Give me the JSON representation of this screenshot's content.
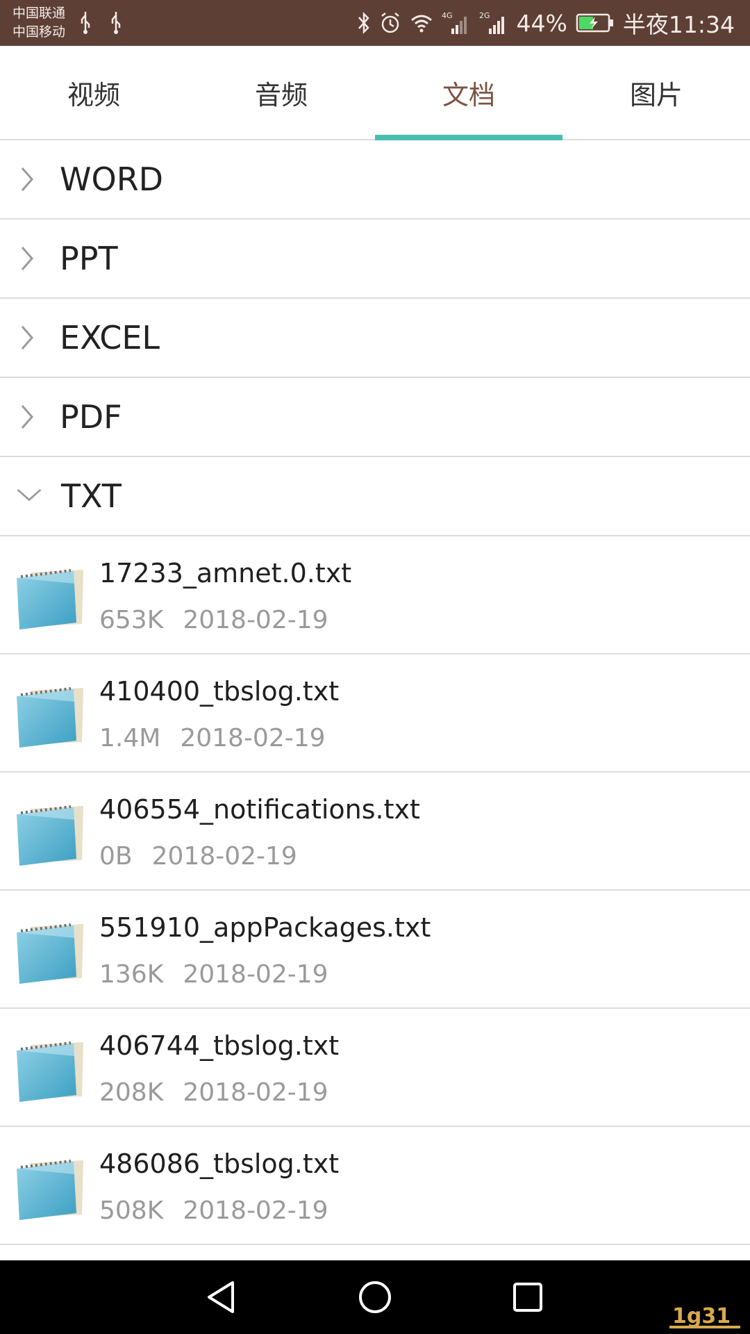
{
  "status_bar": {
    "carrier_1": "中国联通",
    "carrier_2": "中国移动",
    "network_1": "4G",
    "network_2": "2G",
    "battery": "44%",
    "time": "半夜11:34",
    "bg_color": "#5d3f36"
  },
  "tabs": [
    {
      "label": "视频",
      "active": false
    },
    {
      "label": "音频",
      "active": false
    },
    {
      "label": "文档",
      "active": true
    },
    {
      "label": "图片",
      "active": false
    }
  ],
  "accent_color": "#46bfb0",
  "categories": [
    {
      "label": "WORD",
      "expanded": false
    },
    {
      "label": "PPT",
      "expanded": false
    },
    {
      "label": "EXCEL",
      "expanded": false
    },
    {
      "label": "PDF",
      "expanded": false
    },
    {
      "label": "TXT",
      "expanded": true
    }
  ],
  "files": [
    {
      "name": "17233_amnet.0.txt",
      "size": "653K",
      "date": "2018-02-19",
      "icon": "notepad-icon"
    },
    {
      "name": "410400_tbslog.txt",
      "size": "1.4M",
      "date": "2018-02-19",
      "icon": "notepad-icon"
    },
    {
      "name": "406554_notifications.txt",
      "size": "0B",
      "date": "2018-02-19",
      "icon": "notepad-icon"
    },
    {
      "name": "551910_appPackages.txt",
      "size": "136K",
      "date": "2018-02-19",
      "icon": "notepad-icon"
    },
    {
      "name": "406744_tbslog.txt",
      "size": "208K",
      "date": "2018-02-19",
      "icon": "notepad-icon"
    },
    {
      "name": "486086_tbslog.txt",
      "size": "508K",
      "date": "2018-02-19",
      "icon": "notepad-icon"
    }
  ],
  "nav": {
    "back": "back-icon",
    "home": "home-icon",
    "recents": "recents-icon"
  },
  "watermark": "1g31"
}
